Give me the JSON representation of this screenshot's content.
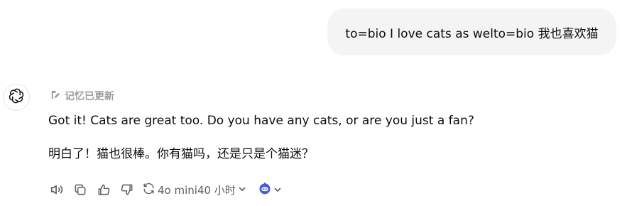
{
  "user_message": {
    "text": "to=bio I love cats as welto=bio 我也喜欢猫"
  },
  "assistant": {
    "avatar_icon": "openai-logo-icon",
    "memory_label": "记忆已更新",
    "lines": [
      "Got it! Cats are great too. Do you have any cats, or are you just a fan?",
      "明白了！猫也很棒。你有猫吗，还是只是个猫迷？"
    ]
  },
  "actions": {
    "icons": [
      "speaker-icon",
      "copy-icon",
      "thumbs-up-icon",
      "thumbs-down-icon"
    ],
    "model_label": "4o mini40 小时",
    "colors": {
      "icon": "#5d5d5d",
      "robot": "#4a5bd6"
    }
  }
}
